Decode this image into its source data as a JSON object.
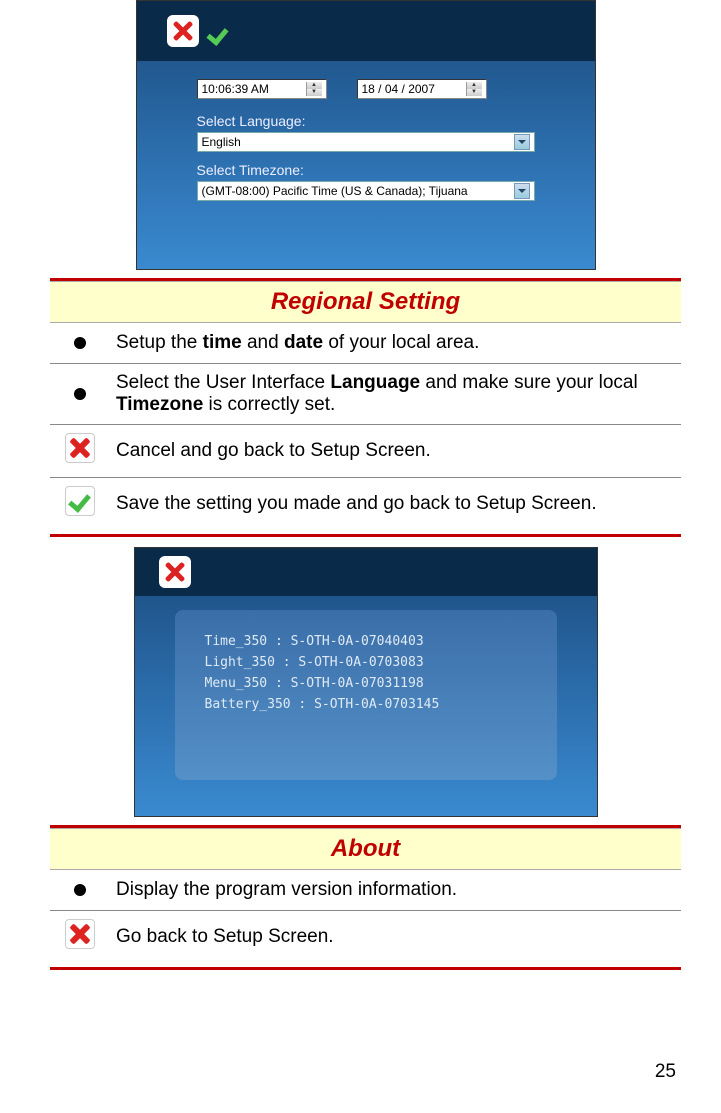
{
  "screenshot1": {
    "time_value": "10:06:39 AM",
    "date_value": "18 / 04 / 2007",
    "lang_label": "Select Language:",
    "lang_value": "English",
    "tz_label": "Select Timezone:",
    "tz_value": "(GMT-08:00) Pacific Time (US & Canada); Tijuana"
  },
  "section1_title": "Regional Setting",
  "section1_rows": {
    "r1_pre": "Setup the ",
    "r1_b1": "time",
    "r1_mid": " and ",
    "r1_b2": "date",
    "r1_post": " of your local area.",
    "r2_pre": "Select the User Interface ",
    "r2_b1": "Language",
    "r2_mid": " and make sure your local ",
    "r2_b2": "Timezone",
    "r2_post": " is correctly set.",
    "r3": "Cancel and go back to Setup Screen.",
    "r4": "Save the setting you made and go back to Setup Screen."
  },
  "screenshot2": {
    "lines": [
      "Time_350 : S-OTH-0A-07040403",
      "Light_350 : S-OTH-0A-0703083",
      "Menu_350 : S-OTH-0A-07031198",
      "Battery_350 : S-OTH-0A-0703145"
    ]
  },
  "section2_title": "About",
  "section2_rows": {
    "r1": "Display the program version information.",
    "r2": "Go back to Setup Screen."
  },
  "page_number": "25"
}
